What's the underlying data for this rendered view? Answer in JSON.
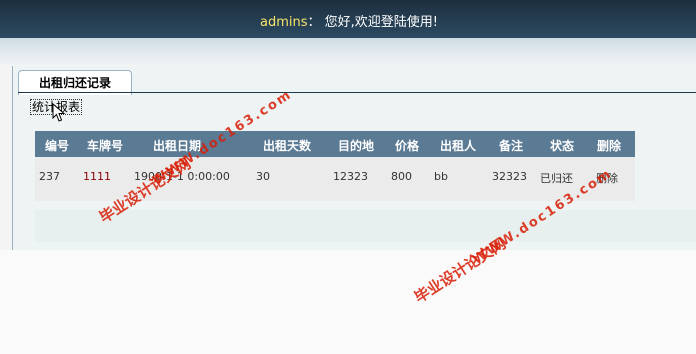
{
  "header": {
    "user": "admins",
    "greeting": "： 您好,欢迎登陆使用!"
  },
  "tab": {
    "label": "出租归还记录"
  },
  "stat_link": "统计报表",
  "table": {
    "headers": [
      "编号",
      "车牌号",
      "出租日期",
      "出租天数",
      "目的地",
      "价格",
      "出租人",
      "备注",
      "状态",
      "删除"
    ],
    "rows": [
      {
        "id": "237",
        "plate": "1111",
        "date": "1900-1-1 0:00:00",
        "days": "30",
        "dest": "12323",
        "price": "800",
        "renter": "bb",
        "note": "32323",
        "status": "已归还",
        "delete": "删除"
      }
    ]
  },
  "watermarks": {
    "site": "WWW.doc163.com",
    "name": "毕业设计论文网"
  }
}
